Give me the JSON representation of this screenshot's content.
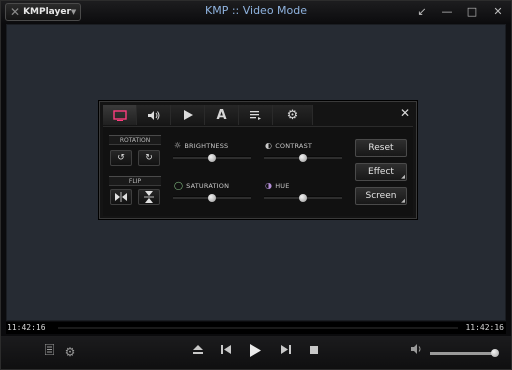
{
  "app": {
    "logo_text": "KMPlayer",
    "window_title": "KMP :: Video Mode"
  },
  "window_controls": {
    "restore_icon": "↙",
    "min_icon": "—",
    "max_icon": "□",
    "close_icon": "✕"
  },
  "panel": {
    "tabs": [
      {
        "name": "screen-tab",
        "glyph": "▭"
      },
      {
        "name": "audio-tab",
        "glyph": "🔊"
      },
      {
        "name": "playback-tab",
        "glyph": "▶"
      },
      {
        "name": "subtitle-tab",
        "glyph": "A"
      },
      {
        "name": "playlist-tab",
        "glyph": "≡"
      },
      {
        "name": "settings-tab",
        "glyph": "⚙"
      }
    ],
    "close_glyph": "✕",
    "rotation_label": "ROTATION",
    "flip_label": "FLIP",
    "rotate_left_glyph": "↺",
    "rotate_right_glyph": "↻",
    "flip_h_glyph": "⧓",
    "flip_v_glyph": "⧗",
    "brightness": {
      "label": "BRIGHTNESS",
      "value": 0.5
    },
    "contrast": {
      "label": "CONTRAST",
      "value": 0.5
    },
    "saturation": {
      "label": "SATURATION",
      "value": 0.5
    },
    "hue": {
      "label": "HUE",
      "value": 0.5
    },
    "reset_label": "Reset",
    "effect_label": "Effect",
    "screen_label": "Screen"
  },
  "player": {
    "time_elapsed": "11:42:16",
    "time_total": "11:42:16",
    "volume": 0.95
  },
  "colors": {
    "title_accent": "#8fb3df",
    "video_bg": "#262b33"
  }
}
